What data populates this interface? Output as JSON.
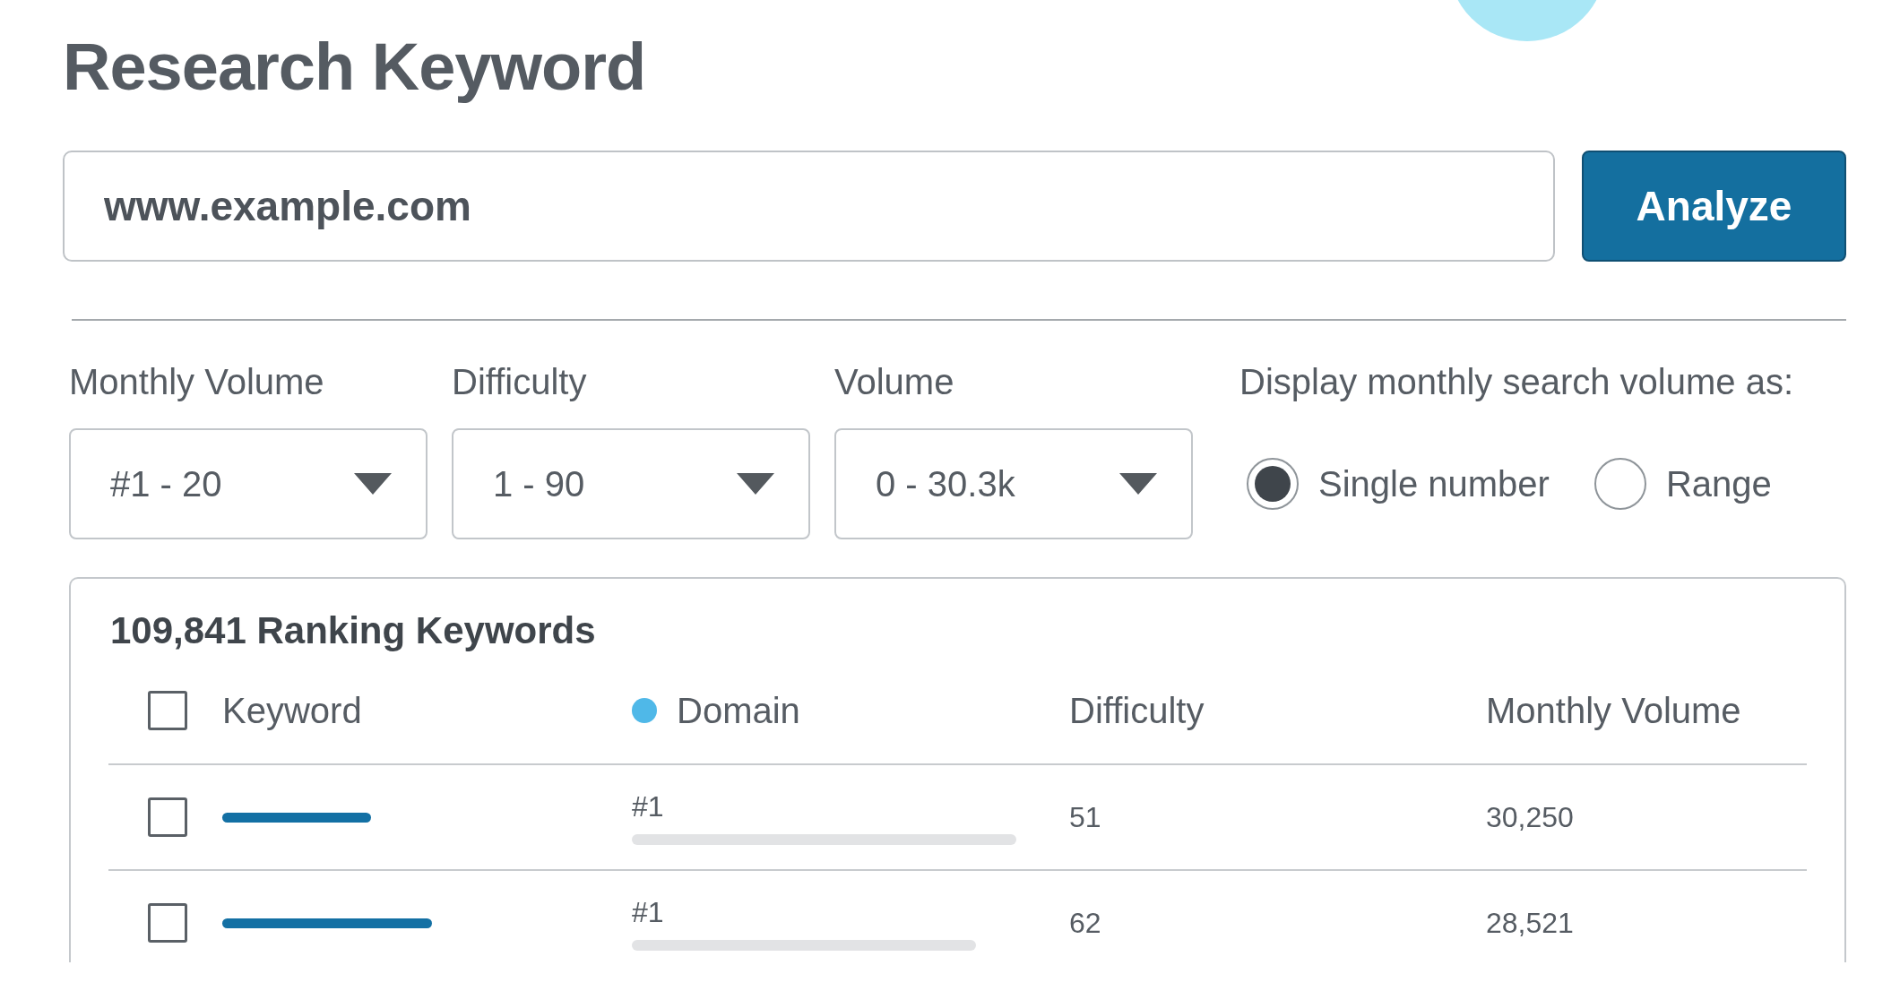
{
  "title": "Research Keyword",
  "search": {
    "value": "www.example.com"
  },
  "analyze_button": "Analyze",
  "filters": [
    {
      "label": "Monthly Volume",
      "value": "#1 - 20"
    },
    {
      "label": "Difficulty",
      "value": "1 - 90"
    },
    {
      "label": "Volume",
      "value": "0 - 30.3k"
    }
  ],
  "display_option": {
    "label": "Display monthly search volume as:",
    "options": [
      {
        "label": "Single number",
        "selected": true
      },
      {
        "label": "Range",
        "selected": false
      }
    ]
  },
  "table": {
    "heading": "109,841 Ranking Keywords",
    "select_all_checked": false,
    "columns": [
      {
        "label": "Keyword"
      },
      {
        "label": "Domain",
        "color": "#4fb8e8"
      },
      {
        "label": "Difficulty"
      },
      {
        "label": "Monthly Volume"
      }
    ],
    "rows": [
      {
        "checked": false,
        "rank": "#1",
        "difficulty": "51",
        "monthly_volume": "30,250"
      },
      {
        "checked": false,
        "rank": "#1",
        "difficulty": "62",
        "monthly_volume": "28,521"
      }
    ]
  }
}
